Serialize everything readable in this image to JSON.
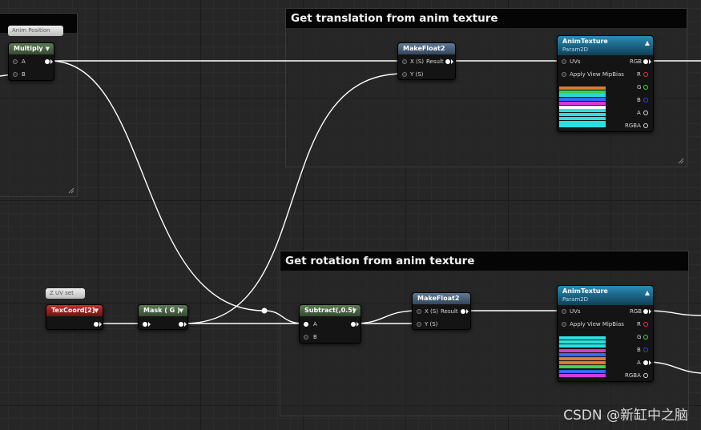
{
  "comments": {
    "left_title": "",
    "translation_title": "Get translation from anim texture",
    "rotation_title": "Get rotation from anim texture"
  },
  "badges": {
    "anim_position": "Anim Position",
    "z_uv_set": "Z UV set"
  },
  "nodes": {
    "multiply": {
      "title": "Multiply",
      "pins": [
        "A",
        "B"
      ]
    },
    "make_float2_top": {
      "title": "MakeFloat2",
      "pins": [
        "X (S)",
        "Y (S)"
      ],
      "output": "Result"
    },
    "anim_texture_top": {
      "title": "AnimTexture",
      "subtitle": "Param2D",
      "inputs": [
        "UVs",
        "Apply View MipBias"
      ],
      "outputs": [
        "RGB",
        "R",
        "G",
        "B",
        "A",
        "RGBA"
      ]
    },
    "texcoord": {
      "title": "TexCoord[2]"
    },
    "mask": {
      "title": "Mask ( G )"
    },
    "subtract": {
      "title": "Subtract(,0.5)",
      "pins": [
        "A",
        "B"
      ]
    },
    "make_float2_bottom": {
      "title": "MakeFloat2",
      "pins": [
        "X (S)",
        "Y (S)"
      ],
      "output": "Result"
    },
    "anim_texture_bottom": {
      "title": "AnimTexture",
      "subtitle": "Param2D",
      "inputs": [
        "UVs",
        "Apply View MipBias"
      ],
      "outputs": [
        "RGB",
        "R",
        "G",
        "B",
        "A",
        "RGBA"
      ]
    }
  },
  "pin_colors": {
    "R": "#ff3030",
    "G": "#35e835",
    "B": "#3a3aff",
    "A": "#ffffff",
    "RGB": "#ffffff",
    "RGBA": "#ffffff"
  },
  "preview_colors": {
    "top": [
      "#e07a2c",
      "#3fd24a",
      "#2bd8d8",
      "#2f6cff",
      "#d43ad4",
      "#ffffff",
      "#2be0e0",
      "#2be0e0",
      "#2be0e0",
      "#2be0e0",
      "#2be0e0"
    ],
    "bottom": [
      "#2be0e0",
      "#2be0e0",
      "#2be0e0",
      "#d43ad4",
      "#2f6cff",
      "#e07a2c",
      "#e07a2c",
      "#3fd24a",
      "#2f6cff",
      "#d43ad4"
    ]
  },
  "accent_colors": {
    "node_green": "#4a6644",
    "node_blue": "#4a6280",
    "node_red": "#9a2020",
    "node_tex": "#1f6f92",
    "comment_title_bg": "#050505"
  },
  "watermark": "CSDN @新缸中之脑"
}
